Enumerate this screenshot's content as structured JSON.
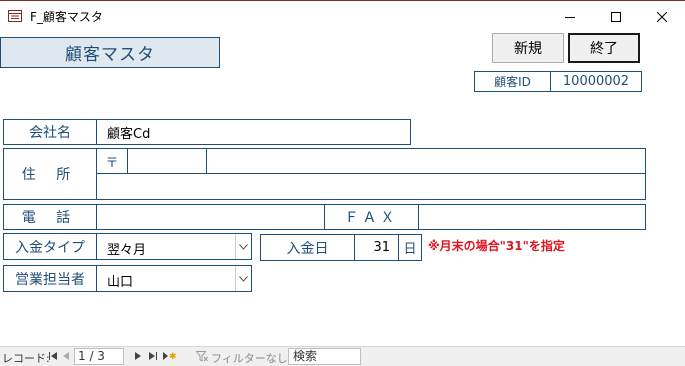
{
  "window": {
    "title": "F_顧客マスタ",
    "icons": [
      "form-icon",
      "minimize-icon",
      "maximize-icon",
      "close-icon"
    ]
  },
  "header": {
    "title": "顧客マスタ"
  },
  "buttons": {
    "new_label": "新規",
    "close_label": "終了"
  },
  "customer_id": {
    "label": "顧客ID",
    "value": "10000002"
  },
  "company": {
    "label": "会社名",
    "value": "顧客Cd"
  },
  "address": {
    "label": "住 所",
    "postal_mark": "〒",
    "postal_value": "",
    "line1": "",
    "line2": ""
  },
  "phone": {
    "label": "電 話",
    "value": "",
    "fax_label": "ＦＡＸ",
    "fax_value": ""
  },
  "payment_type": {
    "label": "入金タイプ",
    "value": "翌々月"
  },
  "payment_day": {
    "label": "入金日",
    "value": "31",
    "unit": "日",
    "note": "※月末の場合\"31\"を指定"
  },
  "sales_rep": {
    "label": "営業担当者",
    "value": "山口"
  },
  "statusbar": {
    "record_label": "レコード:",
    "position": "1 / 3",
    "filter_label": "フィルターなし",
    "search_label": "検索"
  },
  "colors": {
    "accent": "#1f4e79",
    "note": "#e0141e",
    "header_bg": "#dfe7ef"
  }
}
